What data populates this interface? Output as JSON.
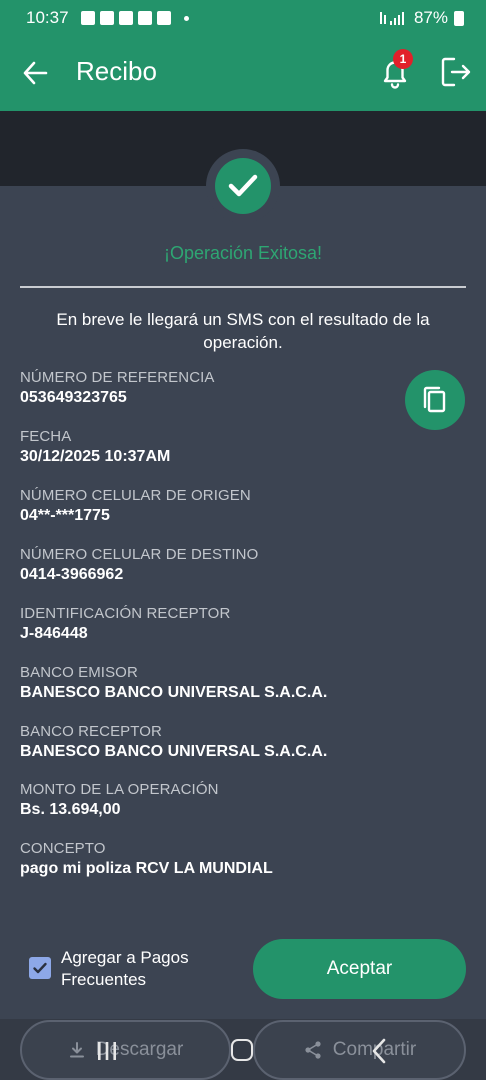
{
  "status_bar": {
    "time": "10:37",
    "battery": "87%"
  },
  "app_bar": {
    "title": "Recibo",
    "notification_count": "1"
  },
  "success": {
    "title": "¡Operación Exitosa!",
    "message": "En breve le llegará un SMS con el resultado de la operación."
  },
  "fields": [
    {
      "label": "NÚMERO DE REFERENCIA",
      "value": "053649323765"
    },
    {
      "label": "FECHA",
      "value": "30/12/2025 10:37AM"
    },
    {
      "label": "NÚMERO CELULAR DE ORIGEN",
      "value": "04**-***1775"
    },
    {
      "label": "NÚMERO CELULAR DE DESTINO",
      "value": "0414-3966962"
    },
    {
      "label": "IDENTIFICACIÓN RECEPTOR",
      "value": "J-846448"
    },
    {
      "label": "BANCO EMISOR",
      "value": "BANESCO BANCO UNIVERSAL S.A.C.A."
    },
    {
      "label": "BANCO RECEPTOR",
      "value": "BANESCO BANCO UNIVERSAL S.A.C.A."
    },
    {
      "label": "MONTO DE LA OPERACIÓN",
      "value": "Bs. 13.694,00"
    },
    {
      "label": "CONCEPTO",
      "value": "pago mi poliza RCV LA MUNDIAL"
    }
  ],
  "frequent_payment": {
    "label": "Agregar a Pagos Frecuentes",
    "checked": true
  },
  "buttons": {
    "accept": "Aceptar",
    "download": "Descargar",
    "share": "Compartir"
  },
  "colors": {
    "brand_green": "#23936a",
    "background": "#3c4452",
    "dark_band": "#21252c",
    "badge_red": "#e1202a",
    "checkbox": "#8da8e8"
  }
}
